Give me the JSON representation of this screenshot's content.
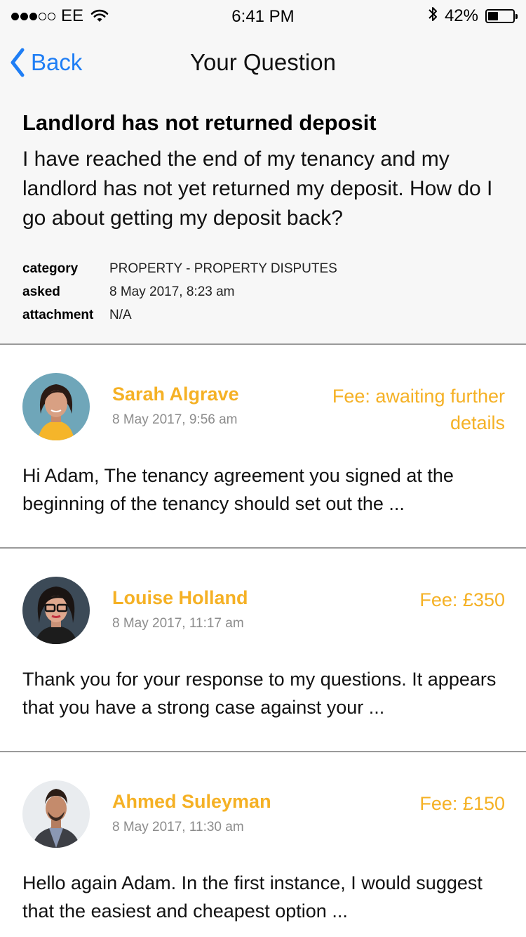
{
  "status_bar": {
    "signal_dots": 5,
    "signal_filled": 3,
    "carrier": "EE",
    "time": "6:41 PM",
    "battery_percent": "42%",
    "battery_level": 0.42
  },
  "nav": {
    "back_label": "Back",
    "title": "Your Question"
  },
  "question": {
    "title": "Landlord has not returned deposit",
    "body": "I have reached the end of my tenancy and my landlord has not yet returned my deposit. How do I go about getting my deposit back?",
    "meta": [
      {
        "key": "category",
        "value": "PROPERTY - PROPERTY DISPUTES"
      },
      {
        "key": "asked",
        "value": "8 May 2017, 8:23 am"
      },
      {
        "key": "attachment",
        "value": "N/A"
      }
    ]
  },
  "answers": [
    {
      "name": "Sarah Algrave",
      "date": "8 May 2017, 9:56 am",
      "fee": "Fee: awaiting further details",
      "preview": "Hi Adam, The tenancy agreement you signed at the beginning of the tenancy should set out the ..."
    },
    {
      "name": "Louise Holland",
      "date": "8 May 2017, 11:17 am",
      "fee": "Fee: £350",
      "preview": "Thank you for your response to my questions. It appears that you have a strong case against your ..."
    },
    {
      "name": "Ahmed Suleyman",
      "date": "8 May 2017, 11:30 am",
      "fee": "Fee: £150",
      "preview": "Hello again Adam. In the first instance, I would suggest that the easiest and cheapest option ..."
    }
  ],
  "colors": {
    "accent_blue": "#1f7ef5",
    "expert_orange": "#f5b125",
    "divider": "#9a9a9a",
    "header_bg": "#f7f7f7"
  }
}
